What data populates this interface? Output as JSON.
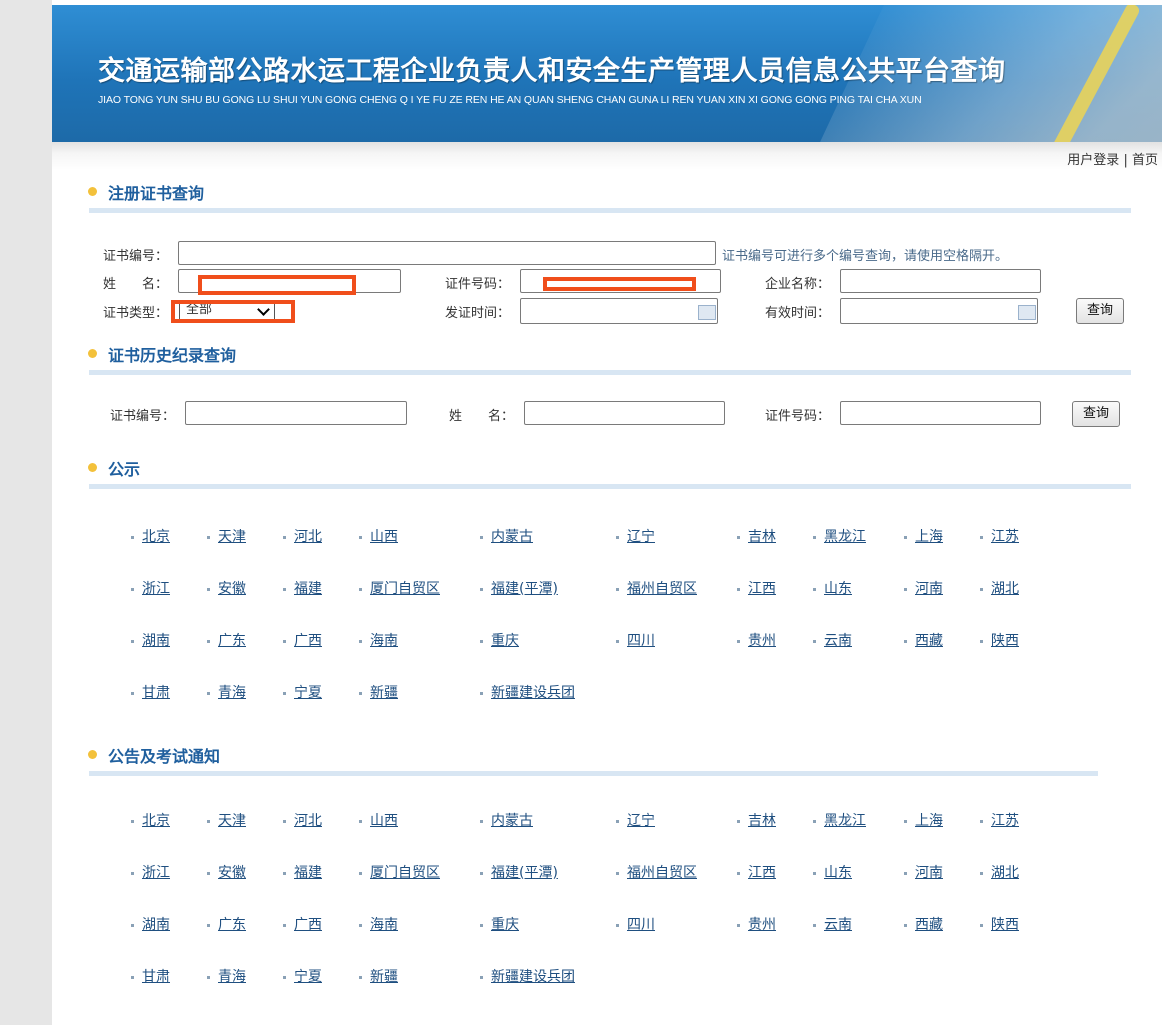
{
  "banner": {
    "title": "交通运输部公路水运工程企业负责人和安全生产管理人员信息公共平台查询",
    "subtitle": "JIAO TONG YUN SHU BU GONG LU SHUI YUN GONG CHENG Q I YE FU ZE REN HE AN QUAN SHENG CHAN GUNA LI REN YUAN XIN XI GONG GONG PING TAI CHA XUN"
  },
  "toplinks": {
    "login": "用户登录",
    "sep": "|",
    "home": "首页"
  },
  "cert_query": {
    "section_title": "注册证书查询",
    "cert_no_label": "证书编号：",
    "cert_no_value": "",
    "cert_no_hint": "证书编号可进行多个编号查询，请使用空格隔开。",
    "name_label": "姓　　名：",
    "id_label": "证件号码：",
    "company_label": "企业名称：",
    "type_label": "证书类型：",
    "type_value": "全部",
    "issue_label": "发证时间：",
    "valid_label": "有效时间：",
    "search_button": "查询"
  },
  "history_query": {
    "section_title": "证书历史纪录查询",
    "cert_no_label": "证书编号：",
    "name_label": "姓　　名：",
    "id_label": "证件号码：",
    "search_button": "查询"
  },
  "notice": {
    "section_title": "公示",
    "provinces": [
      "北京",
      "天津",
      "河北",
      "山西",
      "内蒙古",
      "辽宁",
      "吉林",
      "黑龙江",
      "上海",
      "江苏",
      "浙江",
      "安徽",
      "福建",
      "厦门自贸区",
      "福建(平潭)",
      "福州自贸区",
      "江西",
      "山东",
      "河南",
      "湖北",
      "湖南",
      "广东",
      "广西",
      "海南",
      "重庆",
      "四川",
      "贵州",
      "云南",
      "西藏",
      "陕西",
      "甘肃",
      "青海",
      "宁夏",
      "新疆",
      "新疆建设兵团"
    ]
  },
  "exam_notice": {
    "section_title": "公告及考试通知",
    "provinces": [
      "北京",
      "天津",
      "河北",
      "山西",
      "内蒙古",
      "辽宁",
      "吉林",
      "黑龙江",
      "上海",
      "江苏",
      "浙江",
      "安徽",
      "福建",
      "厦门自贸区",
      "福建(平潭)",
      "福州自贸区",
      "江西",
      "山东",
      "河南",
      "湖北",
      "湖南",
      "广东",
      "广西",
      "海南",
      "重庆",
      "四川",
      "贵州",
      "云南",
      "西藏",
      "陕西",
      "甘肃",
      "青海",
      "宁夏",
      "新疆",
      "新疆建设兵团"
    ]
  },
  "colors": {
    "banner": "#2a86cc",
    "section_title": "#1f5f9e",
    "redaction": "#f04e1b",
    "bullet": "#f3c13b"
  }
}
